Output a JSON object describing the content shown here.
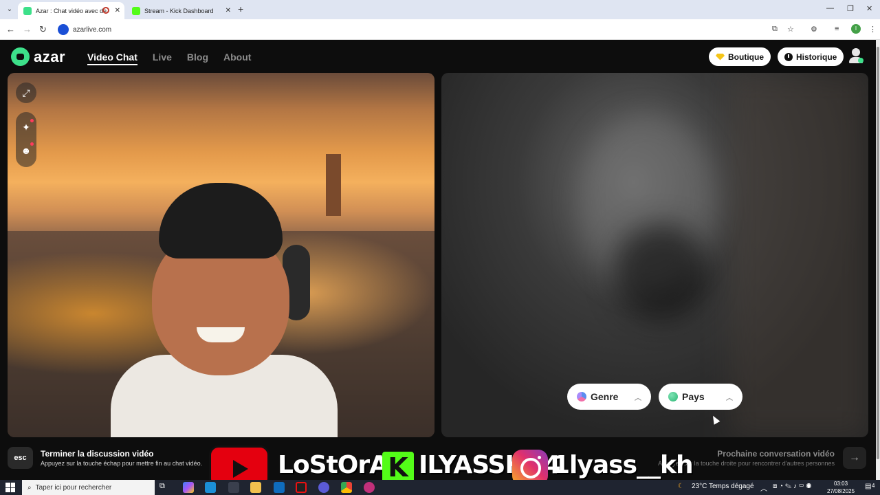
{
  "browser": {
    "tabs": [
      {
        "title": "Azar : Chat vidéo avec de n",
        "active": true
      },
      {
        "title": "Stream - Kick Dashboard",
        "active": false
      }
    ],
    "new_tab": "+",
    "url": "azarlive.com",
    "profile_initial": "I"
  },
  "header": {
    "logo_text": "azar",
    "nav": [
      {
        "label": "Video Chat",
        "active": true
      },
      {
        "label": "Live",
        "active": false
      },
      {
        "label": "Blog",
        "active": false
      },
      {
        "label": "About",
        "active": false
      }
    ],
    "shop_label": "Boutique",
    "history_label": "Historique"
  },
  "filters": {
    "gender_label": "Genre",
    "country_label": "Pays"
  },
  "bottom": {
    "esc_key": "esc",
    "end_title": "Terminer la discussion vidéo",
    "end_sub": "Appuyez sur la touche échap pour mettre fin au chat vidéo.",
    "next_title": "Prochaine conversation vidéo",
    "next_sub": "Appuyez sur la touche droite pour rencontrer d'autres personnes",
    "next_arrow": "→"
  },
  "stream_overlay": {
    "youtube": "LoStOrA",
    "kick": "ILYASSKH4",
    "instagram": "1lyass__kh"
  },
  "taskbar": {
    "search_placeholder": "Taper ici pour rechercher",
    "weather": "23°C  Temps dégagé",
    "time": "03:03",
    "date": "27/08/2025",
    "notification_count": "4"
  },
  "colors": {
    "azar_green": "#3de08a",
    "youtube_red": "#e4000f",
    "kick_green": "#53fc18"
  }
}
